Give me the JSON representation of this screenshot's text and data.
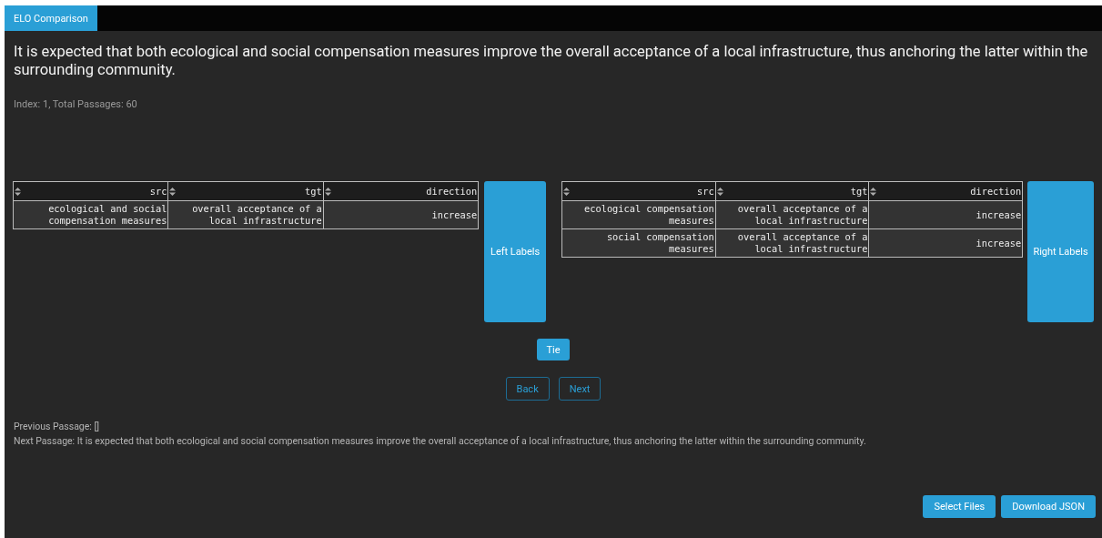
{
  "tabs": [
    {
      "label": "ELO Comparison",
      "selected": true
    }
  ],
  "passage": "It is expected that both ecological and social compensation measures improve the overall acceptance of a local infrastructure, thus anchoring the latter within the surrounding community.",
  "index_info": "Index: 1, Total Passages: 60",
  "left": {
    "columns": [
      "src",
      "tgt",
      "direction"
    ],
    "rows": [
      [
        "ecological and social compensation measures",
        "overall acceptance of a local infrastructure",
        "increase"
      ]
    ],
    "button": "Left Labels"
  },
  "right": {
    "columns": [
      "src",
      "tgt",
      "direction"
    ],
    "rows": [
      [
        "ecological compensation measures",
        "overall acceptance of a local infrastructure",
        "increase"
      ],
      [
        "social compensation measures",
        "overall acceptance of a local infrastructure",
        "increase"
      ]
    ],
    "button": "Right Labels"
  },
  "tie_button": "Tie",
  "nav_buttons": [
    "Back",
    "Next"
  ],
  "previous_passage": "Previous Passage: []",
  "next_passage": "Next Passage: It is expected that both ecological and social compensation measures improve the overall acceptance of a local infrastructure, thus anchoring the latter within the surrounding community.",
  "footer_buttons": [
    "Select Files",
    "Download JSON"
  ]
}
